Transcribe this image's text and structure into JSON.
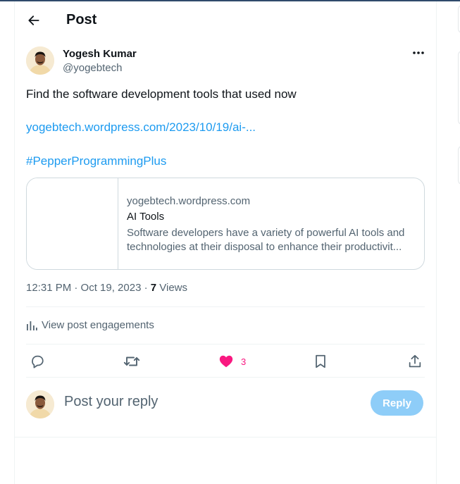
{
  "header": {
    "title": "Post"
  },
  "author": {
    "name": "Yogesh Kumar",
    "handle": "@yogebtech"
  },
  "tweet": {
    "text": "Find the software development tools that used now",
    "link": "yogebtech.wordpress.com/2023/10/19/ai-...",
    "hashtag": "#PepperProgrammingPlus"
  },
  "card": {
    "domain": "yogebtech.wordpress.com",
    "title": "AI Tools",
    "desc_line1": "Software developers have a variety of powerful AI tools and",
    "desc_line2": "technologies at their disposal to enhance their productivit..."
  },
  "meta": {
    "time": "12:31 PM · Oct 19, 2023 · ",
    "views_count": "7",
    "views_label": " Views"
  },
  "engagements": {
    "label": "View post engagements"
  },
  "actions": {
    "like_count": "3"
  },
  "reply": {
    "placeholder": "Post your reply",
    "button": "Reply"
  },
  "colors": {
    "accent": "#1d9bf0",
    "like": "#f91880",
    "reply_button": "#8ecdf8"
  },
  "icons": [
    "back-arrow-icon",
    "more-icon",
    "chart-icon",
    "reply-icon",
    "retweet-icon",
    "heart-icon",
    "bookmark-icon",
    "share-icon"
  ]
}
